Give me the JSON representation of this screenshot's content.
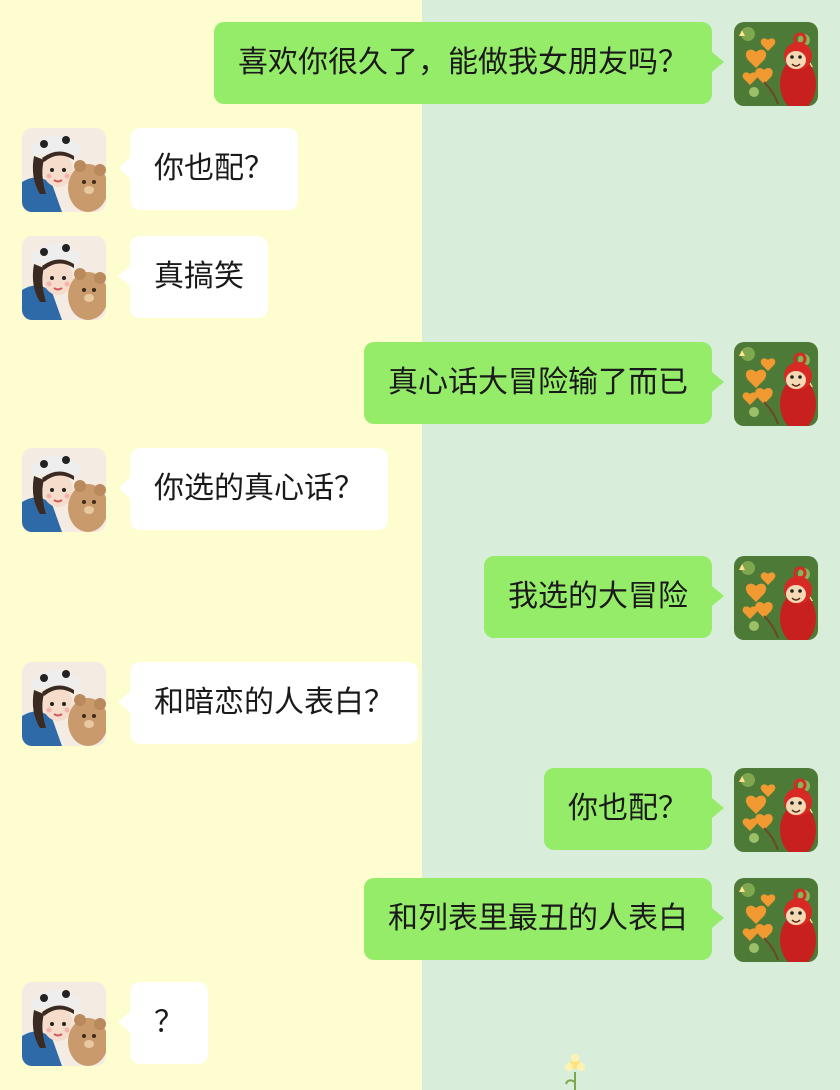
{
  "colors": {
    "left_background": "#fdfdd0",
    "right_background": "#d8eeda",
    "incoming_bubble": "#ffffff",
    "outgoing_bubble": "#95ec69"
  },
  "contacts": {
    "self_avatar": "teletubby-holding-heart-balloons-avatar",
    "other_avatar": "illustrated-girl-with-teddy-bear-avatar"
  },
  "messages": [
    {
      "sender": "self",
      "text": "喜欢你很久了，能做我女朋友吗？"
    },
    {
      "sender": "other",
      "text": "你也配？"
    },
    {
      "sender": "other",
      "text": "真搞笑"
    },
    {
      "sender": "self",
      "text": "真心话大冒险输了而已"
    },
    {
      "sender": "other",
      "text": "你选的真心话？"
    },
    {
      "sender": "self",
      "text": "我选的大冒险"
    },
    {
      "sender": "other",
      "text": "和暗恋的人表白？"
    },
    {
      "sender": "self",
      "text": "你也配？"
    },
    {
      "sender": "self",
      "text": "和列表里最丑的人表白"
    },
    {
      "sender": "other",
      "text": "？"
    }
  ]
}
